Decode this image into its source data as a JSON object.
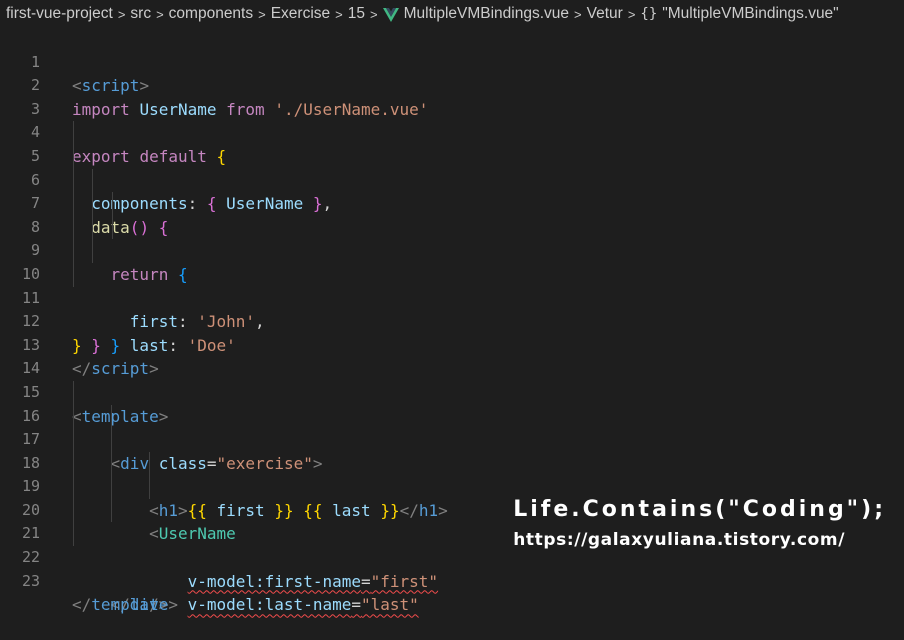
{
  "breadcrumb": {
    "items": [
      "first-vue-project",
      "src",
      "components",
      "Exercise",
      "15",
      "MultipleVMBindings.vue",
      "Vetur",
      "\"MultipleVMBindings.vue\""
    ],
    "separator": ">",
    "braces": "{}"
  },
  "code": {
    "line_numbers": [
      "1",
      "2",
      "3",
      "4",
      "5",
      "6",
      "7",
      "8",
      "9",
      "10",
      "11",
      "12",
      "13",
      "14",
      "15",
      "16",
      "17",
      "18",
      "19",
      "20",
      "21",
      "22",
      "23"
    ],
    "t": {
      "lt": "<",
      "lt_slash": "</",
      "gt": ">",
      "self_close": "/>",
      "script": "script",
      "template": "template",
      "import": "import",
      "UserName": "UserName",
      "from": "from",
      "import_path": "'./UserName.vue'",
      "export": "export",
      "default": "default",
      "lbrace": "{",
      "rbrace": "}",
      "components": "components",
      "colon": ":",
      "comma": ",",
      "data": "data",
      "lparen": "(",
      "rparen": ")",
      "return": "return",
      "first": "first",
      "last": "last",
      "john": "'John'",
      "doe": "'Doe'",
      "div": "div",
      "class": "class",
      "eq": "=",
      "exercise_val": "\"exercise\"",
      "h1": "h1",
      "mustache_open": "{{",
      "mustache_close": "}}",
      "vmodel_first": "v-model:first-name",
      "first_val": "\"first\"",
      "vmodel_last": "v-model:last-name",
      "last_val": "\"last\""
    }
  },
  "watermark": {
    "title": "Life.Contains(\"Coding\");",
    "url": "https://galaxyuliana.tistory.com/"
  }
}
